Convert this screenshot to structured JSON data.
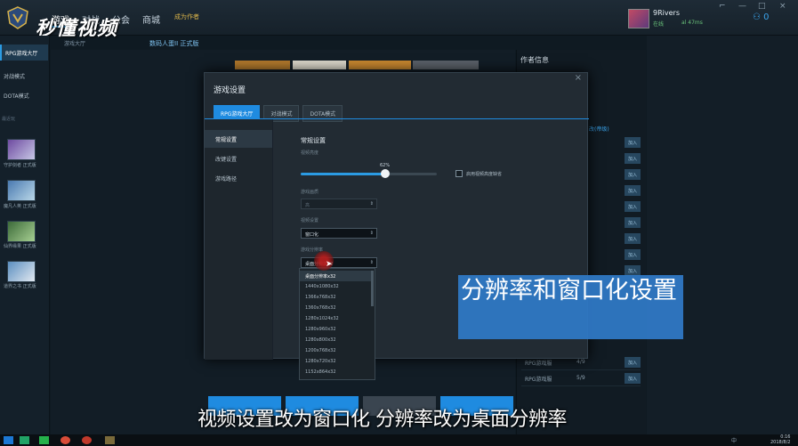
{
  "top_nav": {
    "items": [
      "游戏",
      "对战",
      "公会",
      "商城"
    ],
    "promo": "成为作者",
    "subnav": "游戏大厅",
    "subnav2": "数码人蛋II 正式版"
  },
  "watermark": "秒懂视频",
  "user": {
    "name": "9Rivers",
    "status": "在线",
    "status2": "al 47ms",
    "friend_count": "0"
  },
  "window_buttons": [
    "⌐",
    "—",
    "□",
    "×"
  ],
  "sidebar": {
    "items": [
      "RPG游戏大厅",
      "对战模式",
      "DOTA模式"
    ],
    "recent_label": "最近玩",
    "games": [
      "守护剑者 正式版",
      "魔凡人英 正式版",
      "仙界缘果 正式版",
      "道界之书 正式版"
    ]
  },
  "right_panel": {
    "title": "作者信息",
    "join_label": "加入",
    "rows": [
      {
        "name": "RPG游戏服",
        "count": "4/9"
      },
      {
        "name": "RPG游戏服",
        "count": "5/9"
      }
    ],
    "extra": "改(帝级)"
  },
  "modal": {
    "title": "游戏设置",
    "close": "×",
    "tabs": [
      "RPG游戏大厅",
      "对战模式",
      "DOTA模式"
    ],
    "side_items": [
      "常规设置",
      "改键设置",
      "游戏路径"
    ],
    "section_title": "常规设置",
    "brightness_label": "视频亮度",
    "brightness_value": "62%",
    "brightness_fraction": 0.62,
    "hd_checkbox_label": "启用视频高度缺省",
    "quality_label": "游戏画质",
    "quality_value": "高",
    "display_label": "视频设置",
    "display_value": "窗口化",
    "resolution_label": "游戏分辨率",
    "resolution_value": "桌面分辨率32",
    "resolution_options": [
      "桌面分辨率x32",
      "1440x1080x32",
      "1366x768x32",
      "1360x768x32",
      "1280x1024x32",
      "1280x960x32",
      "1280x800x32",
      "1200x768x32",
      "1280x720x32",
      "1152x864x32"
    ]
  },
  "caption": "分辨率和窗口化设置",
  "subtitle": "视频设置改为窗口化 分辨率改为桌面分辨率",
  "taskbar": {
    "time": "0:16",
    "date": "2018/8/2",
    "ime": "中"
  },
  "colors": {
    "accent": "#1f8be0",
    "caption_bg": "#2f78c4",
    "cursor": "#b41e1e"
  }
}
